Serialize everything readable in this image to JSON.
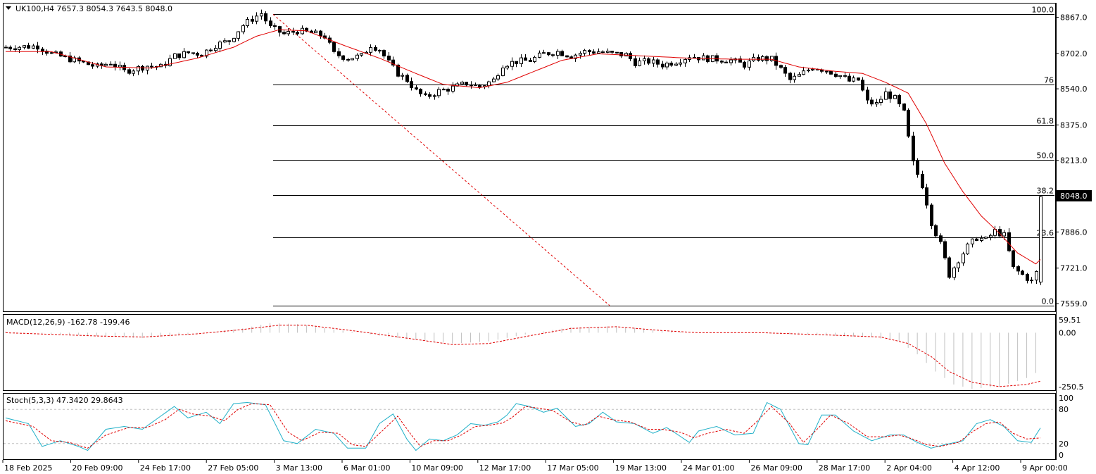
{
  "header": {
    "main": "UK100,H4  7657.3 8054.3 7643.5 8048.0",
    "macd": "MACD(12,26,9) -162.78 -199.46",
    "stoch": "Stoch(5,3,3) 47.3420 29.8643"
  },
  "colors": {
    "background": "#ffffff",
    "candle_up": "#ffffff",
    "candle_down": "#000000",
    "moving_average": "#e00000",
    "macd_histogram": "#c0c0c0",
    "macd_signal": "#e00000",
    "stoch_main": "#20b0c8",
    "stoch_signal": "#e00000",
    "fib_lines": "#000000",
    "fib_trend": "#e00000"
  },
  "chart_data": {
    "type": "candlestick",
    "symbol": "UK100",
    "timeframe": "H4",
    "ohlc_last": {
      "open": 7657.3,
      "high": 8054.3,
      "low": 7643.5,
      "close": 8048.0
    },
    "current_price_label": "8048.0",
    "y_ticks": [
      "8867.0",
      "8702.0",
      "8540.0",
      "8375.0",
      "8213.0",
      "7886.0",
      "7721.0",
      "7559.0"
    ],
    "ylim": [
      7530,
      8920
    ],
    "x_ticks": [
      "18 Feb 2025",
      "20 Feb 09:00",
      "24 Feb 17:00",
      "27 Feb 05:00",
      "3 Mar 13:00",
      "6 Mar 01:00",
      "10 Mar 09:00",
      "12 Mar 17:00",
      "17 Mar 05:00",
      "19 Mar 13:00",
      "24 Mar 01:00",
      "26 Mar 09:00",
      "28 Mar 17:00",
      "2 Apr 04:00",
      "4 Apr 12:00",
      "9 Apr 00:00"
    ],
    "fibonacci": {
      "high": 8880,
      "low": 7550,
      "levels": [
        {
          "label": "100.0",
          "price": 8880
        },
        {
          "label": "76",
          "price": 8560
        },
        {
          "label": "61.8",
          "price": 8372
        },
        {
          "label": "50.0",
          "price": 8215
        },
        {
          "label": "38.2",
          "price": 8055
        },
        {
          "label": "23.6",
          "price": 7861
        },
        {
          "label": "0.0",
          "price": 7550
        }
      ]
    },
    "close_path": [
      [
        0,
        8730
      ],
      [
        7,
        8735
      ],
      [
        10,
        8700
      ],
      [
        15,
        8670
      ],
      [
        20,
        8640
      ],
      [
        23,
        8660
      ],
      [
        26,
        8620
      ],
      [
        28,
        8630
      ],
      [
        31,
        8645
      ],
      [
        34,
        8640
      ],
      [
        37,
        8690
      ],
      [
        40,
        8705
      ],
      [
        43,
        8700
      ],
      [
        46,
        8740
      ],
      [
        49,
        8760
      ],
      [
        52,
        8830
      ],
      [
        54,
        8860
      ],
      [
        56,
        8885
      ],
      [
        58,
        8820
      ],
      [
        61,
        8790
      ],
      [
        64,
        8805
      ],
      [
        67,
        8795
      ],
      [
        70,
        8780
      ],
      [
        72,
        8700
      ],
      [
        75,
        8680
      ],
      [
        78,
        8690
      ],
      [
        80,
        8740
      ],
      [
        82,
        8720
      ],
      [
        84,
        8660
      ],
      [
        86,
        8610
      ],
      [
        88,
        8580
      ],
      [
        90,
        8530
      ],
      [
        92,
        8500
      ],
      [
        95,
        8530
      ],
      [
        98,
        8545
      ],
      [
        101,
        8565
      ],
      [
        104,
        8550
      ],
      [
        107,
        8580
      ],
      [
        109,
        8650
      ],
      [
        112,
        8665
      ],
      [
        115,
        8670
      ],
      [
        118,
        8700
      ],
      [
        121,
        8710
      ],
      [
        124,
        8690
      ],
      [
        127,
        8710
      ],
      [
        130,
        8710
      ],
      [
        133,
        8700
      ],
      [
        136,
        8695
      ],
      [
        138,
        8660
      ],
      [
        141,
        8665
      ],
      [
        144,
        8650
      ],
      [
        147,
        8665
      ],
      [
        150,
        8690
      ],
      [
        153,
        8680
      ],
      [
        156,
        8675
      ],
      [
        159,
        8670
      ],
      [
        162,
        8650
      ],
      [
        165,
        8680
      ],
      [
        168,
        8675
      ],
      [
        170,
        8630
      ],
      [
        172,
        8580
      ],
      [
        174,
        8600
      ],
      [
        177,
        8640
      ],
      [
        180,
        8625
      ],
      [
        183,
        8600
      ],
      [
        185,
        8575
      ],
      [
        187,
        8580
      ],
      [
        189,
        8480
      ],
      [
        191,
        8470
      ],
      [
        193,
        8520
      ],
      [
        195,
        8495
      ],
      [
        197,
        8430
      ],
      [
        199,
        8200
      ],
      [
        201,
        8100
      ],
      [
        202,
        8020
      ],
      [
        203,
        7930
      ],
      [
        205,
        7830
      ],
      [
        207,
        7690
      ],
      [
        209,
        7760
      ],
      [
        211,
        7820
      ],
      [
        213,
        7860
      ],
      [
        215,
        7850
      ],
      [
        217,
        7890
      ],
      [
        219,
        7870
      ],
      [
        221,
        7720
      ],
      [
        223,
        7690
      ],
      [
        225,
        7660
      ],
      [
        226,
        7700
      ],
      [
        227,
        8048
      ]
    ],
    "indicators": {
      "moving_average_path": [
        [
          0,
          8710
        ],
        [
          10,
          8710
        ],
        [
          22,
          8640
        ],
        [
          32,
          8635
        ],
        [
          42,
          8680
        ],
        [
          50,
          8730
        ],
        [
          55,
          8780
        ],
        [
          60,
          8810
        ],
        [
          66,
          8805
        ],
        [
          74,
          8740
        ],
        [
          82,
          8680
        ],
        [
          90,
          8610
        ],
        [
          96,
          8560
        ],
        [
          104,
          8545
        ],
        [
          110,
          8570
        ],
        [
          116,
          8620
        ],
        [
          122,
          8670
        ],
        [
          130,
          8700
        ],
        [
          140,
          8690
        ],
        [
          150,
          8680
        ],
        [
          160,
          8675
        ],
        [
          168,
          8675
        ],
        [
          174,
          8640
        ],
        [
          182,
          8620
        ],
        [
          188,
          8610
        ],
        [
          193,
          8570
        ],
        [
          198,
          8520
        ],
        [
          202,
          8380
        ],
        [
          206,
          8200
        ],
        [
          210,
          8070
        ],
        [
          214,
          7960
        ],
        [
          218,
          7880
        ],
        [
          222,
          7790
        ],
        [
          226,
          7740
        ],
        [
          227,
          7760
        ]
      ],
      "macd": {
        "ylim": [
          -260,
          70
        ],
        "y_ticks": [
          "59.51",
          "0.00",
          "-250.5"
        ],
        "histogram_path": [
          [
            0,
            5
          ],
          [
            20,
            -15
          ],
          [
            30,
            -25
          ],
          [
            40,
            -10
          ],
          [
            52,
            20
          ],
          [
            58,
            45
          ],
          [
            64,
            40
          ],
          [
            74,
            10
          ],
          [
            86,
            -25
          ],
          [
            98,
            -50
          ],
          [
            106,
            -40
          ],
          [
            116,
            0
          ],
          [
            124,
            25
          ],
          [
            134,
            30
          ],
          [
            142,
            15
          ],
          [
            150,
            0
          ],
          [
            164,
            0
          ],
          [
            176,
            -10
          ],
          [
            190,
            -20
          ],
          [
            196,
            -40
          ],
          [
            200,
            -100
          ],
          [
            204,
            -180
          ],
          [
            208,
            -240
          ],
          [
            212,
            -260
          ],
          [
            218,
            -250
          ],
          [
            224,
            -210
          ],
          [
            227,
            -175
          ]
        ],
        "signal_path": [
          [
            0,
            0
          ],
          [
            20,
            -15
          ],
          [
            30,
            -20
          ],
          [
            42,
            -5
          ],
          [
            52,
            15
          ],
          [
            60,
            35
          ],
          [
            66,
            35
          ],
          [
            76,
            10
          ],
          [
            88,
            -25
          ],
          [
            98,
            -55
          ],
          [
            106,
            -50
          ],
          [
            116,
            -10
          ],
          [
            124,
            20
          ],
          [
            134,
            28
          ],
          [
            144,
            10
          ],
          [
            152,
            0
          ],
          [
            166,
            0
          ],
          [
            180,
            -10
          ],
          [
            192,
            -20
          ],
          [
            198,
            -50
          ],
          [
            203,
            -110
          ],
          [
            207,
            -180
          ],
          [
            212,
            -230
          ],
          [
            218,
            -250
          ],
          [
            224,
            -240
          ],
          [
            227,
            -225
          ]
        ]
      },
      "stochastic": {
        "ylim": [
          0,
          100
        ],
        "y_ticks": [
          "100",
          "80",
          "20",
          "0"
        ],
        "levels": [
          80,
          20
        ],
        "main_path": [
          [
            0,
            65
          ],
          [
            5,
            55
          ],
          [
            8,
            15
          ],
          [
            12,
            25
          ],
          [
            16,
            15
          ],
          [
            18,
            8
          ],
          [
            22,
            45
          ],
          [
            26,
            50
          ],
          [
            30,
            45
          ],
          [
            34,
            68
          ],
          [
            37,
            85
          ],
          [
            40,
            65
          ],
          [
            44,
            75
          ],
          [
            47,
            55
          ],
          [
            50,
            90
          ],
          [
            53,
            92
          ],
          [
            57,
            88
          ],
          [
            61,
            25
          ],
          [
            64,
            20
          ],
          [
            68,
            45
          ],
          [
            72,
            38
          ],
          [
            75,
            12
          ],
          [
            79,
            12
          ],
          [
            82,
            55
          ],
          [
            85,
            72
          ],
          [
            88,
            28
          ],
          [
            90,
            8
          ],
          [
            93,
            28
          ],
          [
            96,
            25
          ],
          [
            99,
            35
          ],
          [
            102,
            55
          ],
          [
            105,
            52
          ],
          [
            108,
            58
          ],
          [
            110,
            70
          ],
          [
            112,
            90
          ],
          [
            115,
            85
          ],
          [
            118,
            75
          ],
          [
            121,
            82
          ],
          [
            125,
            50
          ],
          [
            128,
            55
          ],
          [
            131,
            75
          ],
          [
            134,
            58
          ],
          [
            138,
            55
          ],
          [
            142,
            38
          ],
          [
            145,
            48
          ],
          [
            147,
            38
          ],
          [
            150,
            22
          ],
          [
            152,
            42
          ],
          [
            156,
            50
          ],
          [
            160,
            35
          ],
          [
            164,
            38
          ],
          [
            167,
            92
          ],
          [
            170,
            80
          ],
          [
            174,
            20
          ],
          [
            176,
            18
          ],
          [
            179,
            70
          ],
          [
            182,
            70
          ],
          [
            186,
            42
          ],
          [
            190,
            25
          ],
          [
            194,
            35
          ],
          [
            197,
            35
          ],
          [
            200,
            22
          ],
          [
            203,
            12
          ],
          [
            206,
            18
          ],
          [
            210,
            25
          ],
          [
            213,
            55
          ],
          [
            216,
            62
          ],
          [
            219,
            50
          ],
          [
            222,
            25
          ],
          [
            225,
            22
          ],
          [
            227,
            47.342
          ]
        ],
        "signal_path": [
          [
            0,
            60
          ],
          [
            6,
            50
          ],
          [
            10,
            25
          ],
          [
            14,
            22
          ],
          [
            18,
            12
          ],
          [
            22,
            35
          ],
          [
            27,
            48
          ],
          [
            31,
            48
          ],
          [
            35,
            62
          ],
          [
            38,
            80
          ],
          [
            41,
            72
          ],
          [
            45,
            68
          ],
          [
            48,
            60
          ],
          [
            51,
            80
          ],
          [
            54,
            90
          ],
          [
            58,
            88
          ],
          [
            62,
            40
          ],
          [
            65,
            25
          ],
          [
            69,
            40
          ],
          [
            73,
            38
          ],
          [
            76,
            18
          ],
          [
            79,
            15
          ],
          [
            83,
            45
          ],
          [
            86,
            68
          ],
          [
            89,
            35
          ],
          [
            91,
            15
          ],
          [
            94,
            25
          ],
          [
            97,
            25
          ],
          [
            100,
            35
          ],
          [
            103,
            50
          ],
          [
            106,
            52
          ],
          [
            109,
            56
          ],
          [
            111,
            65
          ],
          [
            114,
            85
          ],
          [
            117,
            82
          ],
          [
            120,
            78
          ],
          [
            124,
            58
          ],
          [
            127,
            52
          ],
          [
            130,
            68
          ],
          [
            133,
            62
          ],
          [
            137,
            58
          ],
          [
            141,
            45
          ],
          [
            144,
            45
          ],
          [
            148,
            40
          ],
          [
            151,
            30
          ],
          [
            154,
            38
          ],
          [
            158,
            45
          ],
          [
            162,
            38
          ],
          [
            165,
            60
          ],
          [
            168,
            85
          ],
          [
            172,
            55
          ],
          [
            175,
            22
          ],
          [
            178,
            45
          ],
          [
            181,
            70
          ],
          [
            185,
            55
          ],
          [
            189,
            32
          ],
          [
            193,
            32
          ],
          [
            196,
            35
          ],
          [
            199,
            28
          ],
          [
            202,
            18
          ],
          [
            205,
            15
          ],
          [
            209,
            22
          ],
          [
            212,
            40
          ],
          [
            215,
            55
          ],
          [
            218,
            58
          ],
          [
            221,
            38
          ],
          [
            224,
            28
          ],
          [
            227,
            29.864
          ]
        ]
      }
    }
  }
}
